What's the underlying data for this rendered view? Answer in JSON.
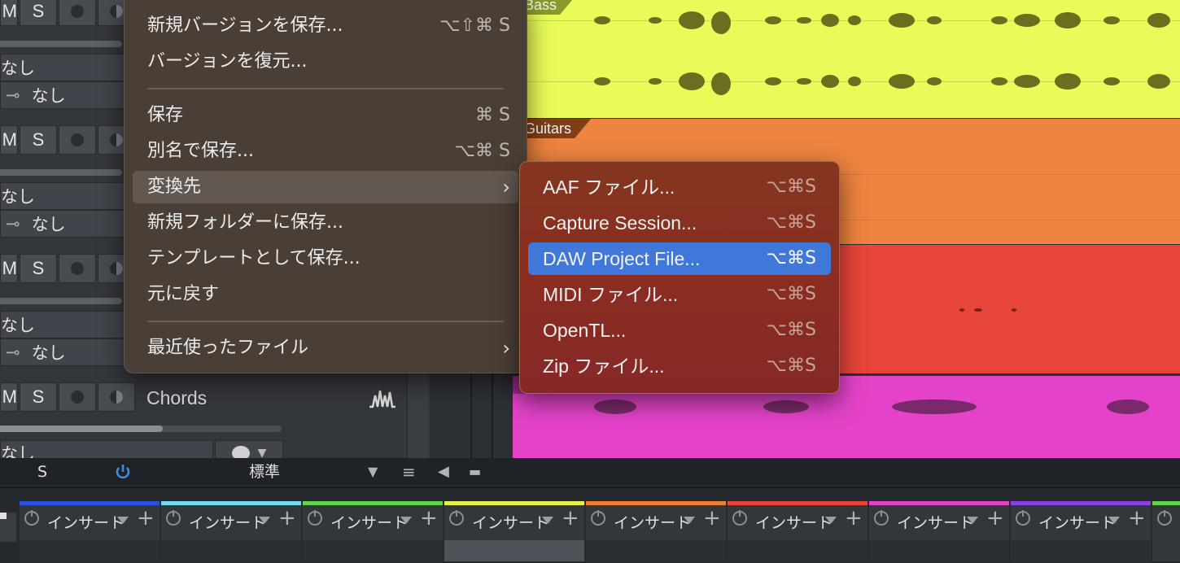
{
  "tracks": {
    "m": "M",
    "s": "S",
    "none": "なし",
    "chords_name": "Chords"
  },
  "lanes": {
    "bass": "Bass",
    "guitars": "Guitars"
  },
  "toolbar": {
    "s": "S",
    "preset": "標準"
  },
  "mixer": {
    "insert": "インサート",
    "strip_colors": [
      "#2b4fe0",
      "#6fd9f0",
      "#5fd64d",
      "#e6f24a",
      "#ef7f33",
      "#e8453a",
      "#e443c9",
      "#8a42e6"
    ]
  },
  "file_menu": {
    "items": [
      {
        "label": "新規バージョンを保存...",
        "shortcut": "⌥⇧⌘ S"
      },
      {
        "label": "バージョンを復元...",
        "shortcut": ""
      },
      {
        "label": "保存",
        "shortcut": "⌘ S"
      },
      {
        "label": "別名で保存...",
        "shortcut": "⌥⌘ S"
      },
      {
        "label": "変換先",
        "shortcut": ""
      },
      {
        "label": "新規フォルダーに保存...",
        "shortcut": ""
      },
      {
        "label": "テンプレートとして保存...",
        "shortcut": ""
      },
      {
        "label": "元に戻す",
        "shortcut": ""
      },
      {
        "label": "最近使ったファイル",
        "shortcut": ""
      }
    ]
  },
  "export_menu": {
    "items": [
      {
        "label": "AAF ファイル...",
        "shortcut": "⌥⌘S"
      },
      {
        "label": "Capture Session...",
        "shortcut": "⌥⌘S"
      },
      {
        "label": "DAW Project File...",
        "shortcut": "⌥⌘S"
      },
      {
        "label": "MIDI ファイル...",
        "shortcut": "⌥⌘S"
      },
      {
        "label": "OpenTL...",
        "shortcut": "⌥⌘S"
      },
      {
        "label": "Zip ファイル...",
        "shortcut": "⌥⌘S"
      }
    ],
    "selected": "DAW Project File..."
  }
}
